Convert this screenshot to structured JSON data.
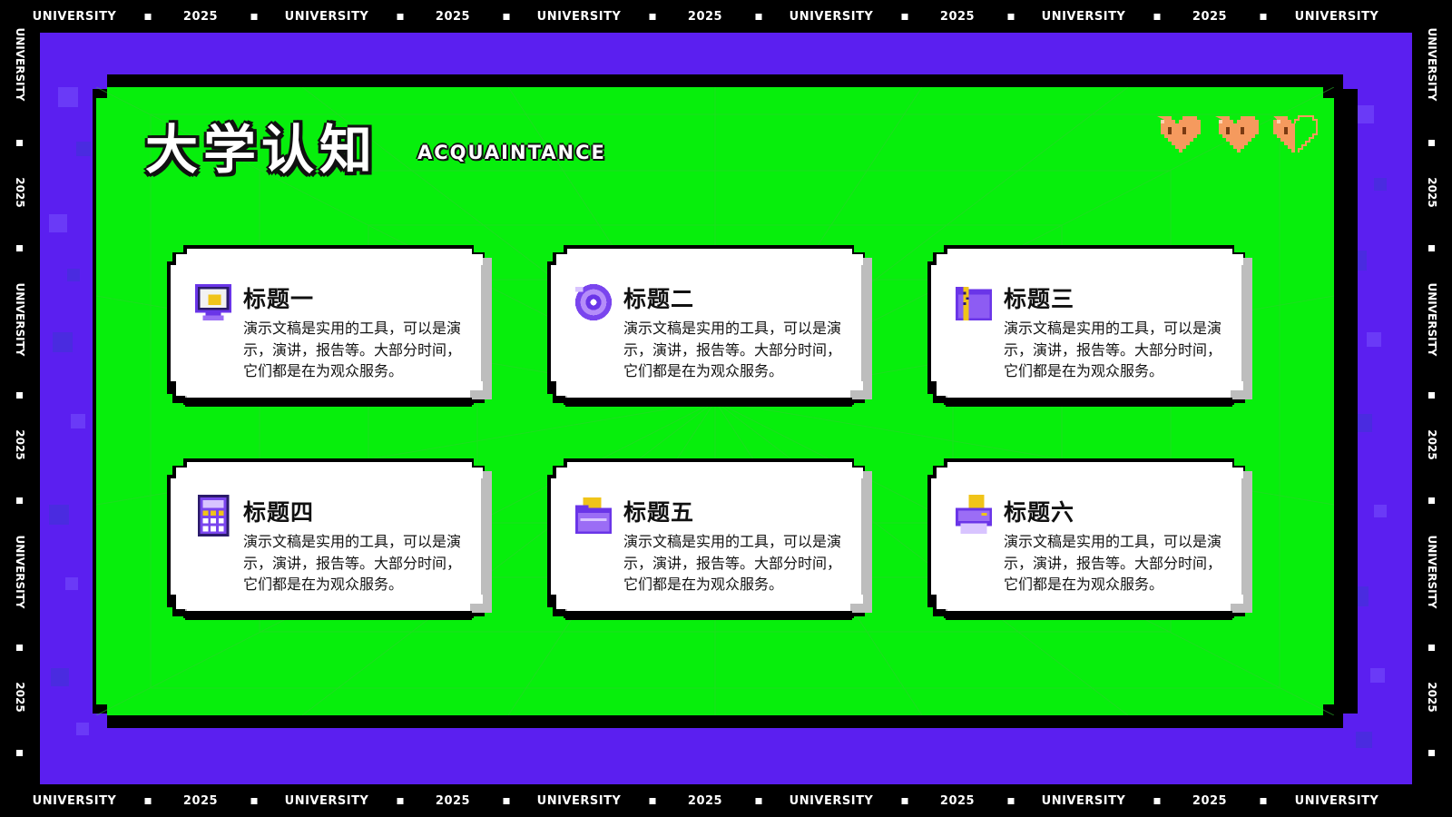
{
  "border": {
    "word": "UNIVERSITY",
    "year": "2025"
  },
  "header": {
    "title": "大学认知",
    "subtitle": "ACQUAINTANCE",
    "hearts": [
      "heart-icon",
      "heart-icon",
      "heart-half-icon"
    ]
  },
  "colors": {
    "frame": "#5b1ff0",
    "board": "#07ef0c",
    "card": "#ffffff",
    "outline": "#000000",
    "heart": "#f59a5e"
  },
  "cards": [
    {
      "title": "标题一",
      "icon": "monitor-icon",
      "body": "演示文稿是实用的工具，可以是演示，演讲，报告等。大部分时间，它们都是在为观众服务。"
    },
    {
      "title": "标题二",
      "icon": "disc-icon",
      "body": "演示文稿是实用的工具，可以是演示，演讲，报告等。大部分时间，它们都是在为观众服务。"
    },
    {
      "title": "标题三",
      "icon": "zip-folder-icon",
      "body": "演示文稿是实用的工具，可以是演示，演讲，报告等。大部分时间，它们都是在为观众服务。"
    },
    {
      "title": "标题四",
      "icon": "calculator-icon",
      "body": "演示文稿是实用的工具，可以是演示，演讲，报告等。大部分时间，它们都是在为观众服务。"
    },
    {
      "title": "标题五",
      "icon": "folder-icon",
      "body": "演示文稿是实用的工具，可以是演示，演讲，报告等。大部分时间，它们都是在为观众服务。"
    },
    {
      "title": "标题六",
      "icon": "printer-icon",
      "body": "演示文稿是实用的工具，可以是演示，演讲，报告等。大部分时间，它们都是在为观众服务。"
    }
  ]
}
